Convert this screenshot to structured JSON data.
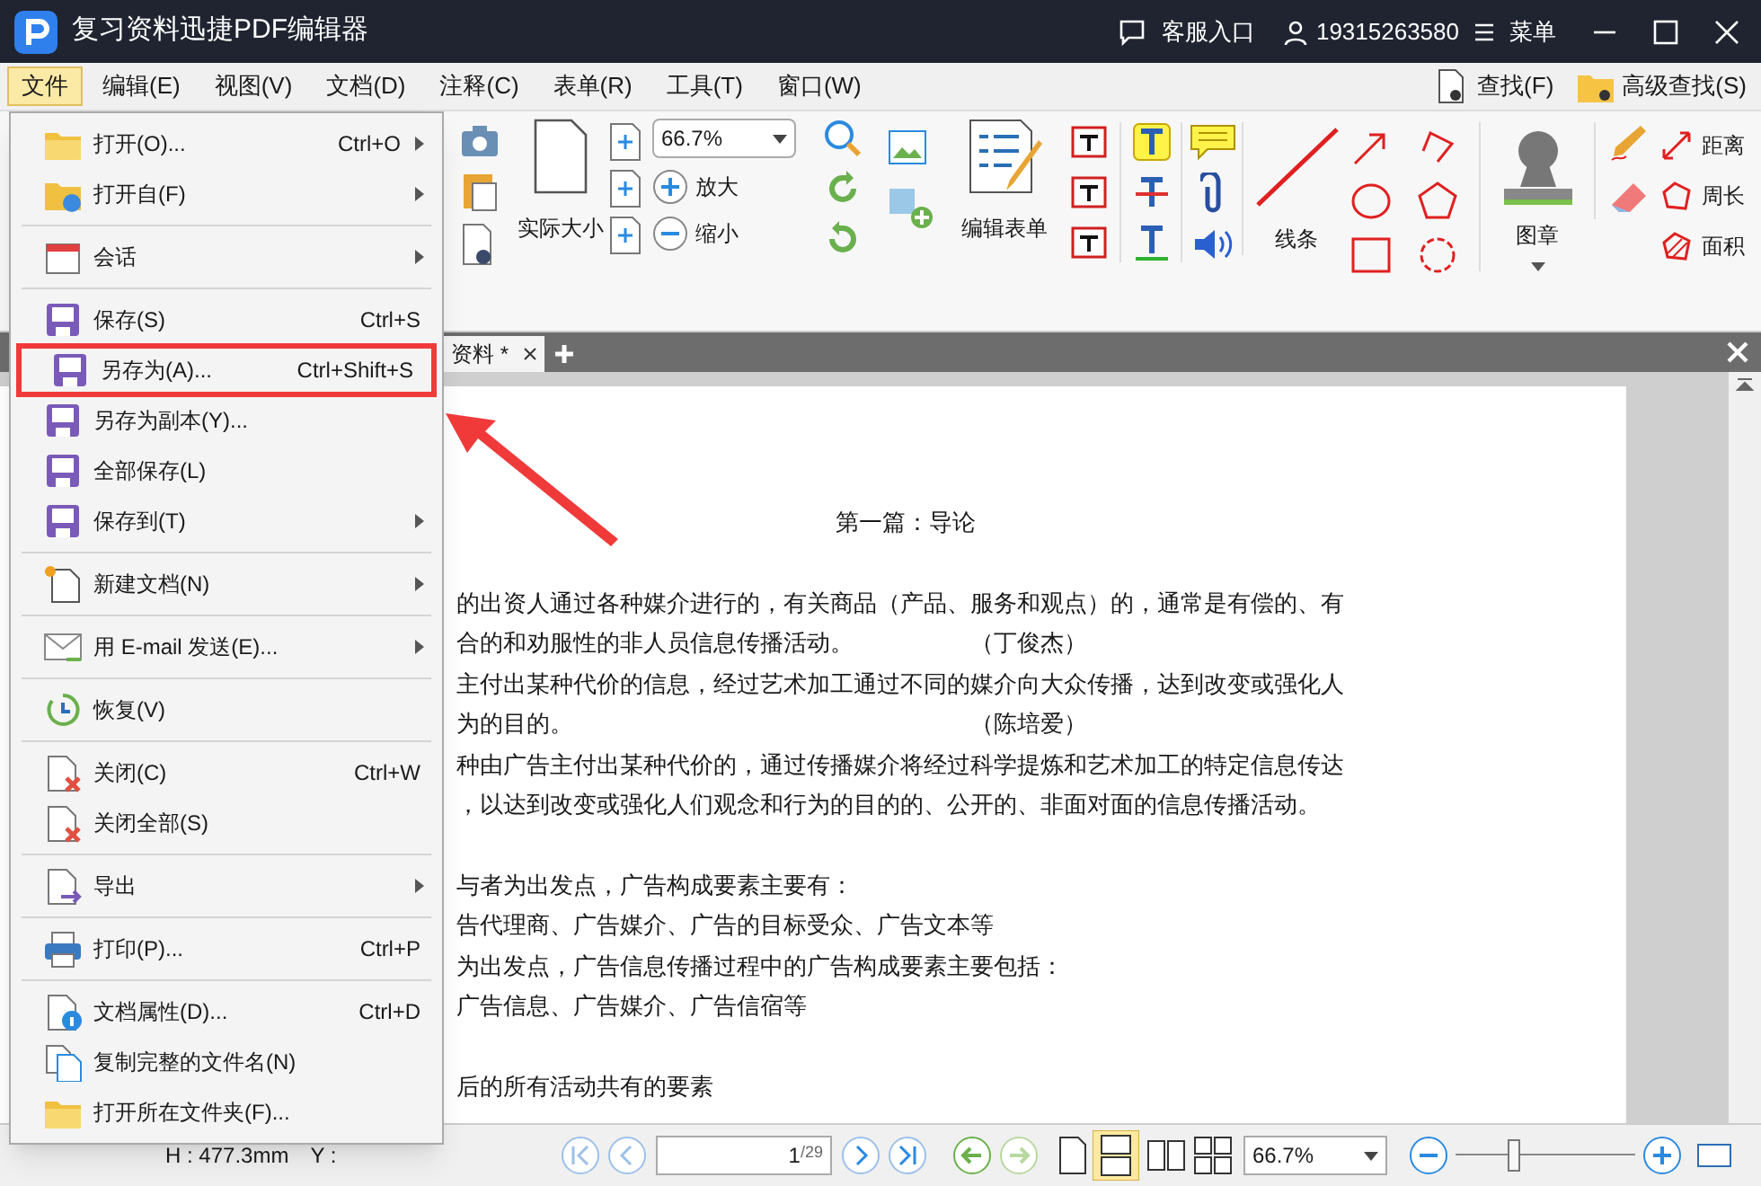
{
  "window": {
    "title": "复习资料迅捷PDF编辑器",
    "support": "客服入口",
    "account": "19315263580",
    "menu_label": "菜单"
  },
  "menu_bar": {
    "items": [
      {
        "label": "文件",
        "selected": true
      },
      {
        "label": "编辑(E)",
        "selected": false
      },
      {
        "label": "视图(V)",
        "selected": false
      },
      {
        "label": "文档(D)",
        "selected": false
      },
      {
        "label": "注释(C)",
        "selected": false
      },
      {
        "label": "表单(R)",
        "selected": false
      },
      {
        "label": "工具(T)",
        "selected": false
      },
      {
        "label": "窗口(W)",
        "selected": false
      }
    ],
    "find": "查找(F)",
    "advanced_find": "高级查找(S)"
  },
  "ribbon": {
    "actual_size": "实际大小",
    "zoom_value": "66.7%",
    "zoom_in": "放大",
    "zoom_out": "缩小",
    "edit_form": "编辑表单",
    "lines": "线条",
    "stamp": "图章",
    "measure": [
      "距离",
      "周长",
      "面积"
    ]
  },
  "tab": {
    "label": "资料 *"
  },
  "file_menu": [
    [
      {
        "label": "打开(O)...",
        "shortcut": "Ctrl+O",
        "submenu": true,
        "callout": false
      },
      {
        "label": "打开自(F)",
        "submenu": true,
        "callout": false
      }
    ],
    [
      {
        "label": "会话",
        "submenu": true,
        "callout": false
      }
    ],
    [
      {
        "label": "保存(S)",
        "shortcut": "Ctrl+S",
        "submenu": false,
        "callout": false
      },
      {
        "label": "另存为(A)...",
        "shortcut": "Ctrl+Shift+S",
        "submenu": false,
        "callout": true
      },
      {
        "label": "另存为副本(Y)...",
        "submenu": false,
        "callout": false
      },
      {
        "label": "全部保存(L)",
        "submenu": false,
        "callout": false
      },
      {
        "label": "保存到(T)",
        "submenu": true,
        "callout": false
      }
    ],
    [
      {
        "label": "新建文档(N)",
        "submenu": true,
        "callout": false
      }
    ],
    [
      {
        "label": "用 E-mail 发送(E)...",
        "submenu": true,
        "callout": false
      }
    ],
    [
      {
        "label": "恢复(V)",
        "submenu": false,
        "callout": false
      }
    ],
    [
      {
        "label": "关闭(C)",
        "shortcut": "Ctrl+W",
        "submenu": false,
        "callout": false
      },
      {
        "label": "关闭全部(S)",
        "submenu": false,
        "callout": false
      }
    ],
    [
      {
        "label": "导出",
        "submenu": true,
        "callout": false
      }
    ],
    [
      {
        "label": "打印(P)...",
        "shortcut": "Ctrl+P",
        "submenu": false,
        "callout": false
      }
    ],
    [
      {
        "label": "文档属性(D)...",
        "shortcut": "Ctrl+D",
        "submenu": false,
        "callout": false
      },
      {
        "label": "复制完整的文件名(N)",
        "submenu": false,
        "callout": false
      },
      {
        "label": "打开所在文件夹(F)...",
        "submenu": false,
        "callout": false
      }
    ]
  ],
  "document": {
    "heading": "第一篇：导论",
    "paragraphs": [
      [
        {
          "text": "的出资人通过各种媒介进行的，有关商品（产品、服务和观点）的，通常是有偿的、有"
        },
        {
          "text": "合的和劝服性的非人员信息传播活动。",
          "note": "（丁俊杰）"
        },
        {
          "text": "主付出某种代价的信息，经过艺术加工通过不同的媒介向大众传播，达到改变或强化人"
        },
        {
          "text": "为的目的。",
          "note": "（陈培爱）"
        },
        {
          "text": "种由广告主付出某种代价的，通过传播媒介将经过科学提炼和艺术加工的特定信息传达"
        },
        {
          "text": "，以达到改变或强化人们观念和行为的目的的、公开的、非面对面的信息传播活动。"
        }
      ],
      [
        {
          "text": "与者为出发点，广告构成要素主要有："
        },
        {
          "text": "告代理商、广告媒介、广告的目标受众、广告文本等"
        },
        {
          "text": "为出发点，广告信息传播过程中的广告构成要素主要包括："
        },
        {
          "text": "广告信息、广告媒介、广告信宿等"
        }
      ],
      [
        {
          "text": "后的所有活动共有的要素"
        }
      ]
    ]
  },
  "status_bar": {
    "height": "H : 477.3mm",
    "y": "Y :",
    "page": "1",
    "page_total": "/29",
    "zoom": "66.7%",
    "zoom_slider": {
      "level": 0.32
    }
  }
}
